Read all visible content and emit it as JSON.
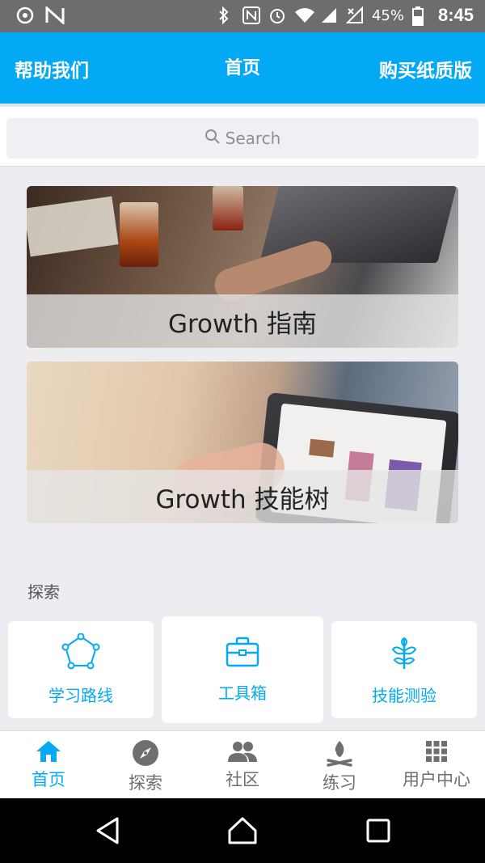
{
  "status_bar": {
    "battery": "45%",
    "time": "8:45"
  },
  "header": {
    "left_label": "帮助我们",
    "title": "首页",
    "right_label": "购买纸质版"
  },
  "search": {
    "placeholder": "Search"
  },
  "cards": [
    {
      "label": "Growth 指南"
    },
    {
      "label": "Growth 技能树"
    }
  ],
  "explore": {
    "title": "探索",
    "tiles": [
      {
        "label": "学习路线",
        "icon": "route-icon"
      },
      {
        "label": "工具箱",
        "icon": "toolbox-icon"
      },
      {
        "label": "技能测验",
        "icon": "sprout-icon"
      }
    ]
  },
  "bottom_nav": {
    "items": [
      {
        "label": "首页",
        "icon": "home-icon",
        "active": true
      },
      {
        "label": "探索",
        "icon": "compass-icon",
        "active": false
      },
      {
        "label": "社区",
        "icon": "people-icon",
        "active": false
      },
      {
        "label": "练习",
        "icon": "campfire-icon",
        "active": false
      },
      {
        "label": "用户中心",
        "icon": "grid-icon",
        "active": false
      }
    ]
  },
  "colors": {
    "primary": "#03a9f4",
    "status_bar": "#6d6d6d",
    "background": "#ececf1"
  }
}
